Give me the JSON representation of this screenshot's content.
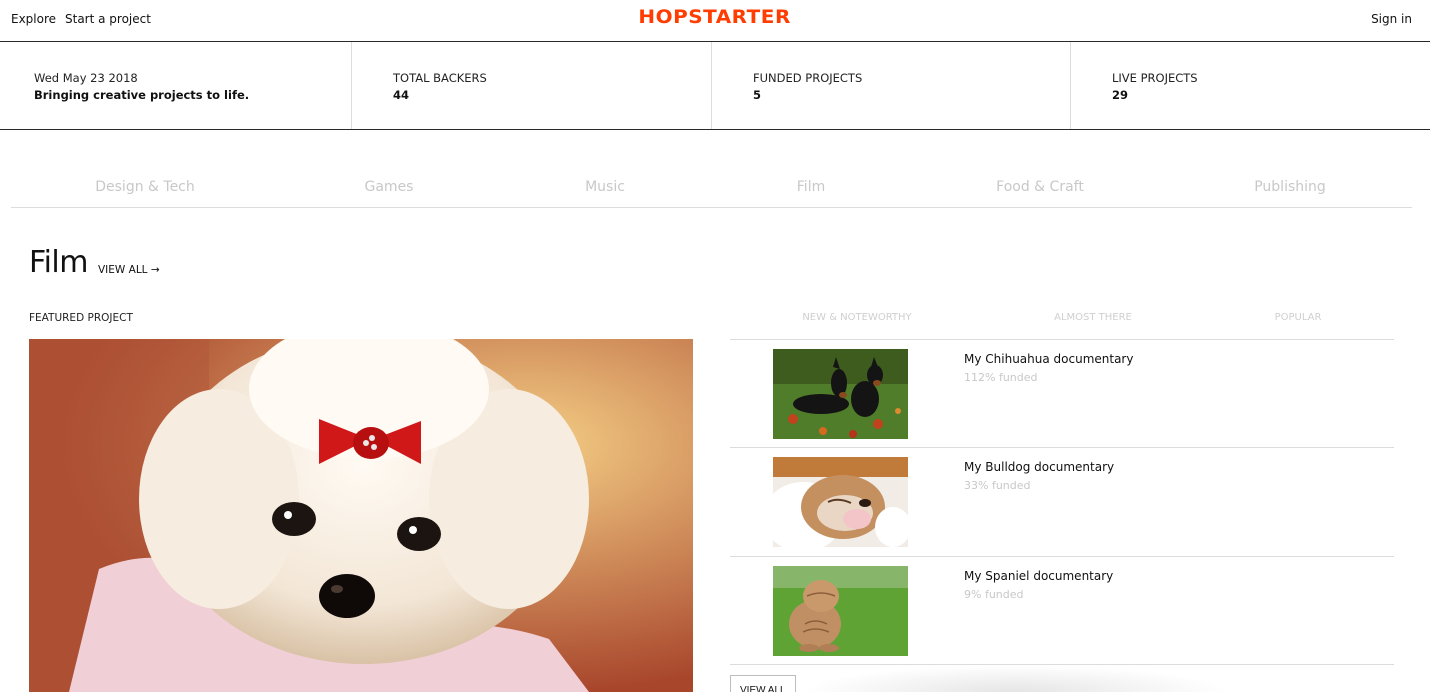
{
  "nav": {
    "explore": "Explore",
    "start_project": "Start a project",
    "logo": "HOPSTARTER",
    "sign_in": "Sign in"
  },
  "colors": {
    "brand": "#ff3d00",
    "muted": "#c8c8c8"
  },
  "stats": {
    "date": "Wed May 23 2018",
    "tagline": "Bringing creative projects to life.",
    "backers_label": "TOTAL BACKERS",
    "backers_value": "44",
    "funded_label": "FUNDED PROJECTS",
    "funded_value": "5",
    "live_label": "LIVE PROJECTS",
    "live_value": "29"
  },
  "categories": [
    "Design & Tech",
    "Games",
    "Music",
    "Film",
    "Food & Craft",
    "Publishing"
  ],
  "section": {
    "title": "Film",
    "view_all": "VIEW ALL →",
    "featured_label": "FEATURED PROJECT"
  },
  "right_tabs": [
    "NEW & NOTEWORTHY",
    "ALMOST THERE",
    "POPULAR"
  ],
  "projects": [
    {
      "title": "My Chihuahua documentary",
      "funded": "112% funded",
      "image": "two-dobermans-on-leaves"
    },
    {
      "title": "My Bulldog documentary",
      "funded": "33% funded",
      "image": "sleeping-bulldog"
    },
    {
      "title": "My Spaniel documentary",
      "funded": "9% funded",
      "image": "shar-pei-puppy-on-grass"
    }
  ],
  "featured_image": "white-maltese-puppy-red-bow",
  "list_view_all": "VIEW ALL"
}
